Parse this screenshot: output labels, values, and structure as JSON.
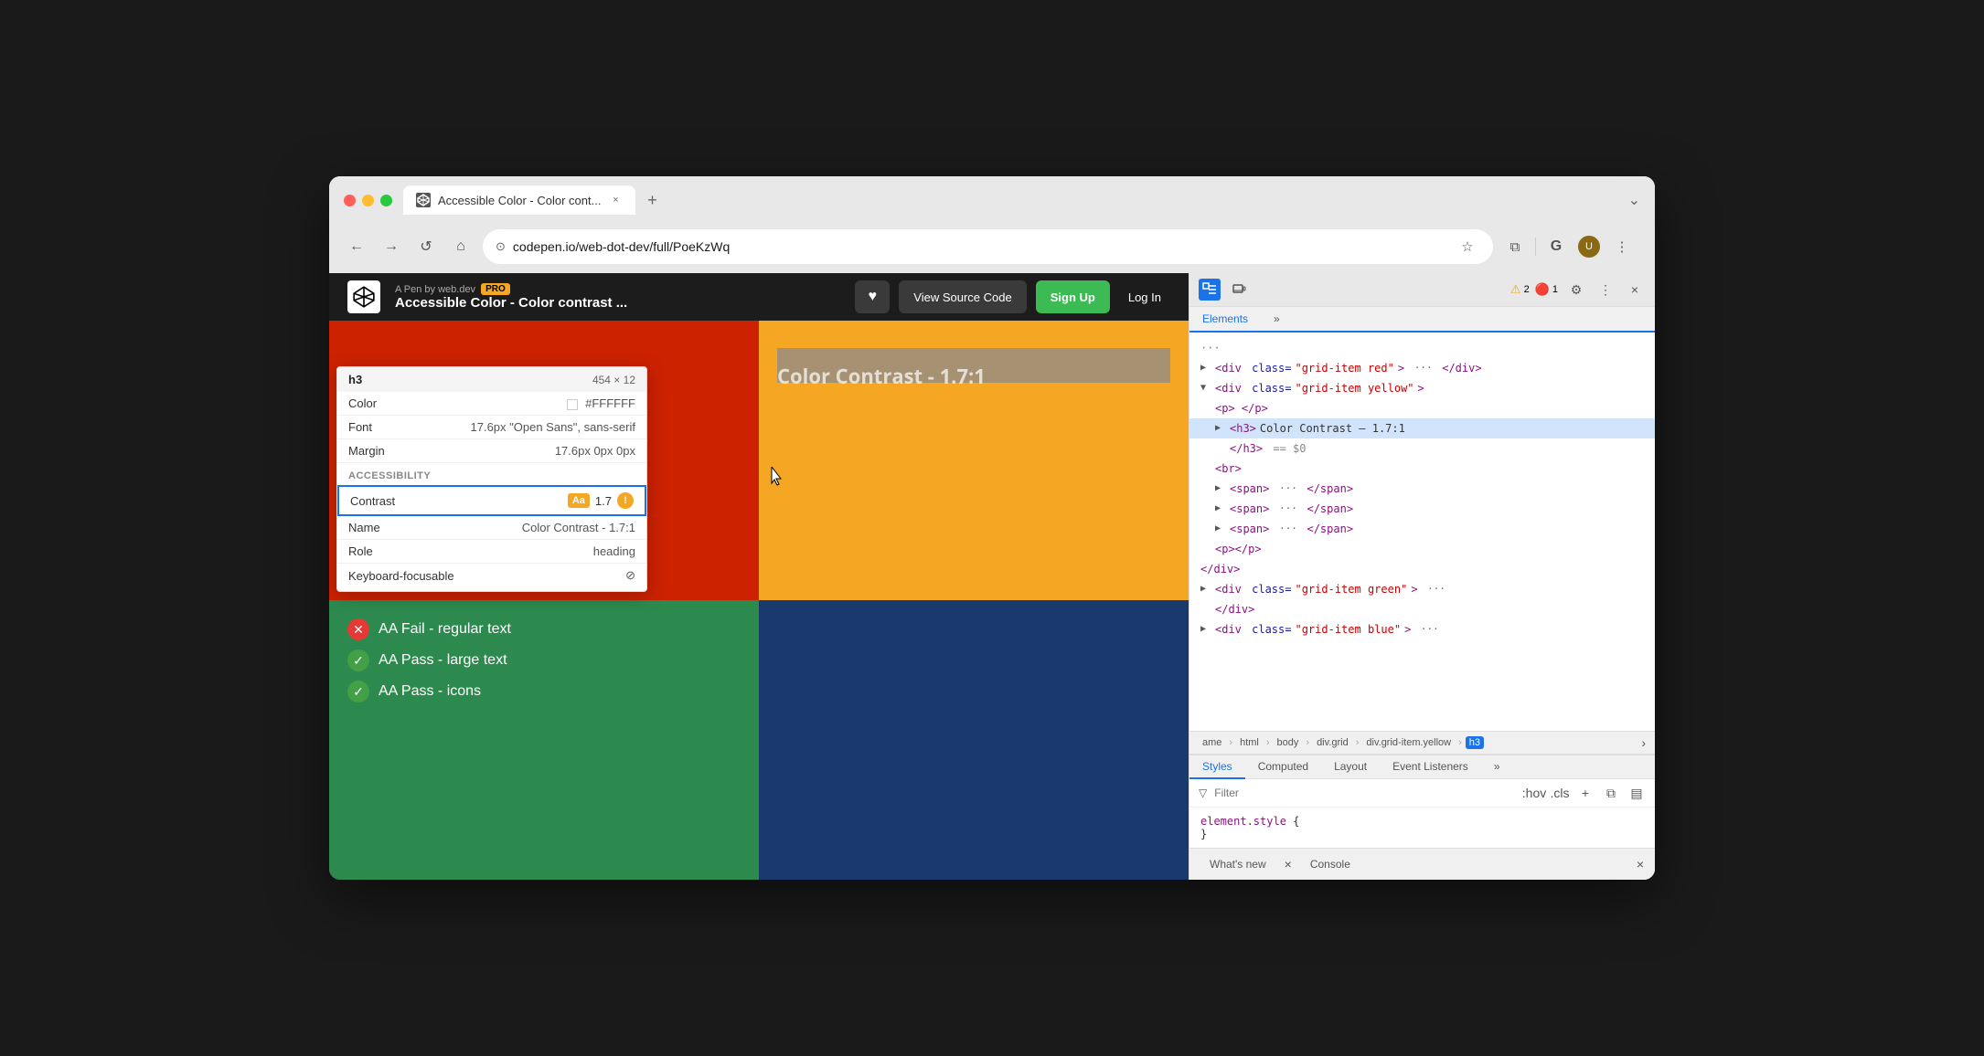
{
  "browser": {
    "tab_title": "Accessible Color - Color cont...",
    "tab_close": "×",
    "tab_new": "+",
    "tab_list": "⌄",
    "url": "codepen.io/web-dot-dev/full/PoeKzWq",
    "nav_back": "←",
    "nav_forward": "→",
    "nav_reload": "↺",
    "nav_home": "⌂",
    "address_icon": "⊙",
    "star_icon": "☆",
    "extensions_icon": "⧉",
    "google_icon": "G",
    "profile_icon": "👤",
    "menu_icon": "⋮"
  },
  "codepen": {
    "logo": "◈",
    "meta_text": "A Pen by web.dev",
    "pro_badge": "PRO",
    "pen_title": "Accessible Color - Color contrast ...",
    "heart_label": "♥",
    "view_source_label": "View Source Code",
    "signup_label": "Sign Up",
    "login_label": "Log In"
  },
  "preview": {
    "heading": "Color Contrast - 1.7:1",
    "fail_items": [
      "AA Fail - regular text"
    ],
    "pass_items": [
      "AA Pass - large text",
      "AA Pass - icons"
    ],
    "colors": {
      "yellow": "#f5a623",
      "green": "#2d8a4e",
      "red": "#cc2200",
      "blue": "#1a3a6e"
    }
  },
  "inspector": {
    "title": "h3",
    "dimensions": "454 × 12",
    "rows": [
      {
        "label": "Color",
        "value": "#FFFFFF",
        "has_swatch": true
      },
      {
        "label": "Font",
        "value": "17.6px \"Open Sans\", sans-serif"
      },
      {
        "label": "Margin",
        "value": "17.6px 0px 0px"
      }
    ],
    "accessibility_header": "ACCESSIBILITY",
    "contrast_label": "Contrast",
    "contrast_aa": "Aa",
    "contrast_value": "1.7",
    "name_label": "Name",
    "name_value": "Color Contrast - 1.7:1",
    "role_label": "Role",
    "role_value": "heading",
    "keyboard_label": "Keyboard-focusable",
    "keyboard_value": "⊘"
  },
  "devtools": {
    "toolbar": {
      "inspect_icon": "⬚",
      "device_icon": "▭",
      "more_icon": "»",
      "alerts_warning": "2",
      "alerts_error": "1",
      "settings_icon": "⚙",
      "kebab_icon": "⋮",
      "close_icon": "×"
    },
    "tabs": [
      "Elements",
      "»"
    ],
    "active_tab": "Elements",
    "elements": [
      {
        "indent": 0,
        "expanded": false,
        "content": "<div class=\"grid-item red\"> ··· </div>"
      },
      {
        "indent": 0,
        "expanded": true,
        "content": "<div class=\"grid-item yellow\">"
      },
      {
        "indent": 1,
        "expanded": false,
        "content": "<p> </p>"
      },
      {
        "indent": 1,
        "expanded": false,
        "content": "<h3>Color Contrast - 1.7:1"
      },
      {
        "indent": 2,
        "expanded": false,
        "content": "</h3> == $0"
      },
      {
        "indent": 1,
        "expanded": false,
        "content": "<br>"
      },
      {
        "indent": 1,
        "expanded": false,
        "content": "<span> ··· </span>"
      },
      {
        "indent": 1,
        "expanded": false,
        "content": "<span> ··· </span>"
      },
      {
        "indent": 1,
        "expanded": false,
        "content": "<span> ··· </span>"
      },
      {
        "indent": 1,
        "expanded": false,
        "content": "<p></p>"
      },
      {
        "indent": 0,
        "expanded": false,
        "content": "</div>"
      },
      {
        "indent": 0,
        "expanded": false,
        "content": "<div class=\"grid-item green\"> ···"
      },
      {
        "indent": 1,
        "expanded": false,
        "content": "</div>"
      },
      {
        "indent": 0,
        "expanded": false,
        "content": "<div class=\"grid-item blue\"> ···"
      }
    ],
    "breadcrumbs": [
      "ame",
      "html",
      "body",
      "div.grid",
      "div.grid-item.yellow",
      "h3"
    ],
    "active_breadcrumb": "h3",
    "styles_tabs": [
      "Styles",
      "Computed",
      "Layout",
      "Event Listeners",
      "»"
    ],
    "active_style_tab": "Styles",
    "filter_placeholder": "Filter",
    "filter_label": "Filter",
    "style_toggles": [
      ":hov",
      ".cls",
      "+"
    ],
    "element_style": "element.style {",
    "element_style_close": "}",
    "bottom_tabs": [
      "What's new",
      "Console"
    ],
    "bottom_close": "×",
    "whats_new_close": "×"
  }
}
